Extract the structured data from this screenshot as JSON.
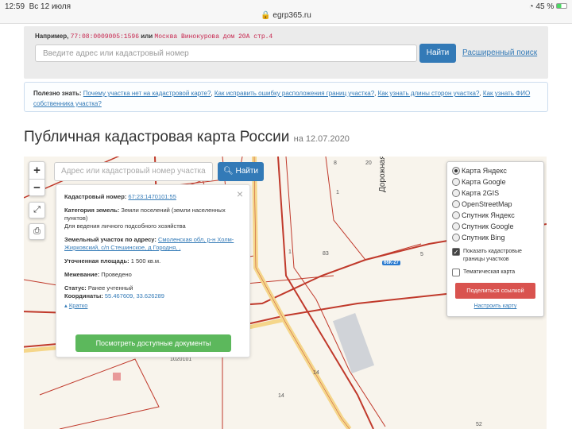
{
  "status": {
    "time": "12:59",
    "date": "Вс 12 июля",
    "battery": "45 %",
    "url": "egrp365.ru"
  },
  "search": {
    "example_label": "Например,",
    "example_cad": "77:08:0009005:1596",
    "example_or": "или",
    "example_addr": "Москва Винокурова дом 20А стр.4",
    "placeholder": "Введите адрес или кадастровый номер",
    "button": "Найти",
    "advanced": "Расширенный поиск"
  },
  "tips": {
    "label": "Полезно знать:",
    "links": [
      "Почему участка нет на кадастровой карте?",
      "Как исправить ошибку расположения границ участка?",
      "Как узнать длины сторон участка?",
      "Как узнать ФИО собственника участка?"
    ]
  },
  "page": {
    "title": "Публичная кадастровая карта России",
    "date": "на 12.07.2020"
  },
  "map": {
    "zoom_in": "+",
    "zoom_out": "−",
    "search_placeholder": "Адрес или кадастровый номер участка",
    "search_button": "Найти",
    "labels": [
      "8",
      "20",
      "1",
      "1",
      "83",
      "5",
      "14",
      "14",
      "52",
      "1020101",
      "Дорожная у"
    ],
    "road_badge": "66К-27",
    "popup": {
      "cad_label": "Кадастровый номер:",
      "cad_value": "67:23:1470101:55",
      "cat_label": "Категория земель:",
      "cat_value": "Земли поселений (земли населенных пунктов)",
      "use": "Для ведения личного подсобного хозяйства",
      "addr_label": "Земельный участок по адресу:",
      "addr_value": "Смоленская обл, р-н Холм-Жирковский, с/п Стешинское, д Городня, ,",
      "area_label": "Уточненная площадь:",
      "area_value": "1 500 кв.м.",
      "survey_label": "Межевание:",
      "survey_value": "Проведено",
      "status_label": "Статус:",
      "status_value": "Ранее учтенный",
      "coord_label": "Координаты:",
      "coord_value": "55.467609, 33.626289",
      "collapse": "Кратко",
      "docs_button": "Посмотреть доступные документы"
    },
    "layers": {
      "options": [
        "Карта Яндекс",
        "Карта Google",
        "Карта 2GIS",
        "OpenStreetMap",
        "Спутник Яндекс",
        "Спутник Google",
        "Спутник Bing"
      ],
      "selected": 0,
      "show_borders": "Показать кадастровые границы участков",
      "thematic": "Тематическая карта",
      "share": "Поделиться ссылкой",
      "setup": "Настроить карту"
    }
  }
}
